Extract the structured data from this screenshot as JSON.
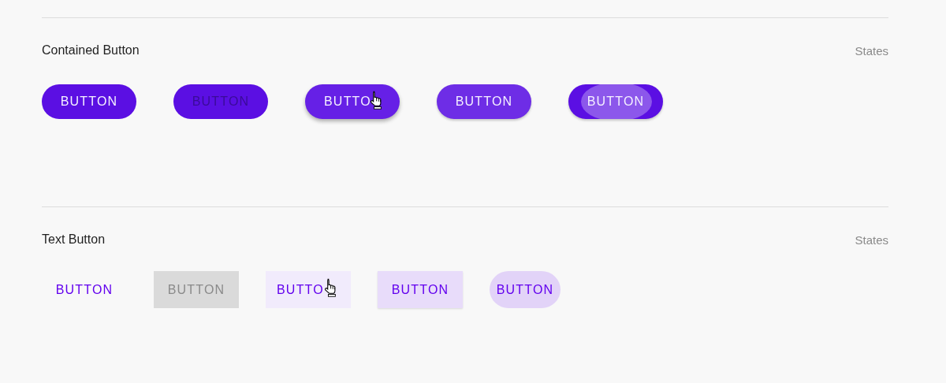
{
  "sections": [
    {
      "title": "Contained Button",
      "aside": "States",
      "kind": "contained",
      "buttons": [
        {
          "label": "BUTTON",
          "kind": "enabled"
        },
        {
          "label": "BUTTON",
          "kind": "dimmed"
        },
        {
          "label": "BUTTO",
          "kind": "hovered"
        },
        {
          "label": "BUTTON",
          "kind": "focused"
        },
        {
          "label": "BUTTON",
          "kind": "pressed"
        }
      ]
    },
    {
      "title": "Text Button",
      "aside": "States",
      "kind": "text",
      "buttons": [
        {
          "label": "BUTTON",
          "kind": "enabled"
        },
        {
          "label": "BUTTON",
          "kind": "dimmed"
        },
        {
          "label": "BUTTO",
          "kind": "hovered"
        },
        {
          "label": "BUTTON",
          "kind": "focused"
        },
        {
          "label": "BUTTON",
          "kind": "pressed"
        }
      ]
    }
  ]
}
